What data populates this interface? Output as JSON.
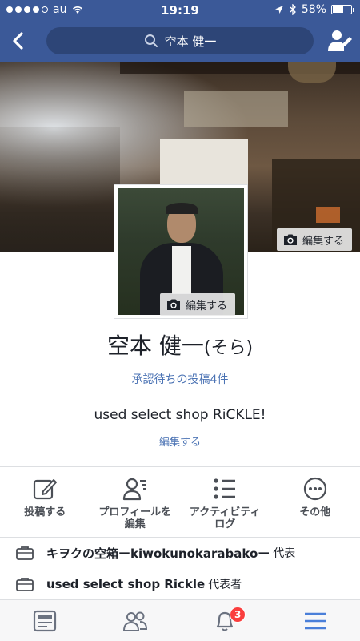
{
  "status_bar": {
    "carrier": "au",
    "time": "19:19",
    "battery": "58%",
    "battery_level": 0.58
  },
  "nav": {
    "search_text": "空本 健一"
  },
  "profile": {
    "name": "空本 健一",
    "nickname": "(そら)",
    "pending_posts": "承認待ちの投稿4件",
    "bio": "used select shop RiCKLE!",
    "bio_edit": "編集する",
    "cover_edit": "編集する",
    "avatar_edit": "編集する"
  },
  "actions": [
    {
      "icon": "compose-icon",
      "label": "投稿する"
    },
    {
      "icon": "profile-info-icon",
      "label": "プロフィールを\n編集"
    },
    {
      "icon": "activity-log-icon",
      "label": "アクティビティ\nログ"
    },
    {
      "icon": "more-icon",
      "label": "その他"
    }
  ],
  "work": [
    {
      "place": "キヲクの空箱ーkiwokunokarabakoー",
      "role": "代表"
    },
    {
      "place": "used select shop Rickle",
      "role": "代表者"
    }
  ],
  "tabbar": {
    "notifications_badge": "3",
    "accent": "#4a7fd9"
  }
}
